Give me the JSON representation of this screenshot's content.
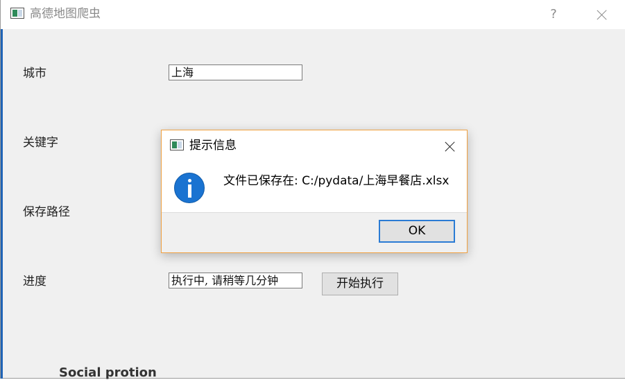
{
  "window": {
    "title": "高德地图爬虫",
    "help_label": "?"
  },
  "form": {
    "city_label": "城市",
    "city_value": "上海",
    "keyword_label": "关键字",
    "save_path_label": "保存路径",
    "progress_label": "进度",
    "progress_value": "执行中, 请稍等几分钟",
    "start_button_label": "开始执行"
  },
  "background_clip_text": "Social protion",
  "dialog": {
    "title": "提示信息",
    "message": "文件已保存在: C:/pydata/上海早餐店.xlsx",
    "ok_label": "OK",
    "icon": "info-icon"
  },
  "colors": {
    "dialog_border": "#f0a040",
    "info_icon": "#1a73d1",
    "ok_focus_border": "#2a7bd4"
  }
}
